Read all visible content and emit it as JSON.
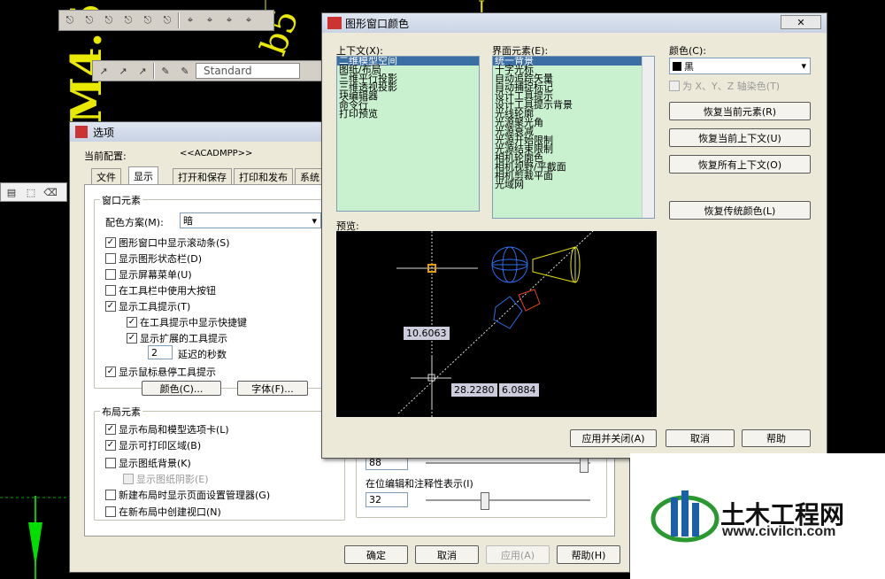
{
  "background": {
    "vertical_text": "M4.5",
    "bg_color": "#000000",
    "accent_yellow": "#e8e800"
  },
  "cad_toolbar": {
    "style_value": "Standard"
  },
  "options_dialog": {
    "title": "选项",
    "current_profile_label": "当前配置:",
    "current_profile_value": "<<ACADMPP>>",
    "tabs": [
      "文件",
      "显示",
      "打开和保存",
      "打印和发布",
      "系统"
    ],
    "window_elements": {
      "label": "窗口元素",
      "color_scheme_label": "配色方案(M):",
      "color_scheme_value": "暗",
      "items": [
        {
          "label": "图形窗口中显示滚动条(S)",
          "checked": true
        },
        {
          "label": "显示图形状态栏(D)",
          "checked": false
        },
        {
          "label": "显示屏幕菜单(U)",
          "checked": false
        },
        {
          "label": "在工具栏中使用大按钮",
          "checked": false
        },
        {
          "label": "显示工具提示(T)",
          "checked": true
        },
        {
          "label": "在工具提示中显示快捷键",
          "checked": true
        },
        {
          "label": "显示扩展的工具提示",
          "checked": true
        },
        {
          "label": "显示鼠标悬停工具提示",
          "checked": true
        }
      ],
      "delay_value": "2",
      "delay_label": "延迟的秒数",
      "colors_button": "颜色(C)...",
      "fonts_button": "字体(F)..."
    },
    "layout_elements": {
      "label": "布局元素",
      "items": [
        {
          "label": "显示布局和模型选项卡(L)",
          "checked": true
        },
        {
          "label": "显示可打印区域(B)",
          "checked": true
        },
        {
          "label": "显示图纸背景(K)",
          "checked": false
        },
        {
          "label": "显示图纸阴影(E)",
          "checked": false,
          "disabled": true
        },
        {
          "label": "新建布局时显示页面设置管理器(G)",
          "checked": false
        },
        {
          "label": "在新布局中创建视口(N)",
          "checked": false
        }
      ]
    },
    "right_panel": {
      "value1": "88",
      "slider1_fraction": 0.95,
      "inplace_label": "在位编辑和注释性表示(I)",
      "value2": "32",
      "slider2_fraction": 0.37
    },
    "buttons": {
      "ok": "确定",
      "cancel": "取消",
      "apply": "应用(A)",
      "help": "帮助(H)"
    }
  },
  "color_dialog": {
    "title": "图形窗口颜色",
    "close": "✕",
    "context_label": "上下文(X):",
    "contexts": [
      "二维模型空间",
      "图纸/布局",
      "三维平行投影",
      "三维透视投影",
      "块编辑器",
      "命令行",
      "打印预览"
    ],
    "element_label": "界面元素(E):",
    "elements": [
      "统一背景",
      "十字光标",
      "自动追踪矢量",
      "自动捕捉标记",
      "设计工具提示",
      "设计工具提示背景",
      "光线轮廓",
      "光源聚光角",
      "光源衰减",
      "光源开始限制",
      "光源结束限制",
      "相机轮廓色",
      "相机视野/平截面",
      "相机剪裁平面",
      "光域网"
    ],
    "color_label": "颜色(C):",
    "color_value": "黑",
    "tint_label": "为 X、Y、Z 轴染色(T)",
    "restore_element": "恢复当前元素(R)",
    "restore_context": "恢复当前上下文(U)",
    "restore_all": "恢复所有上下文(O)",
    "restore_classic": "恢复传统颜色(L)",
    "preview_label": "预览:",
    "preview_values": {
      "dist": "10.6063",
      "x": "28.2280",
      "y": "6.0884"
    },
    "apply_close": "应用并关闭(A)",
    "cancel": "取消",
    "help": "帮助"
  },
  "watermark": {
    "brand": "土木工程网",
    "url": "www.civilcn.com"
  }
}
